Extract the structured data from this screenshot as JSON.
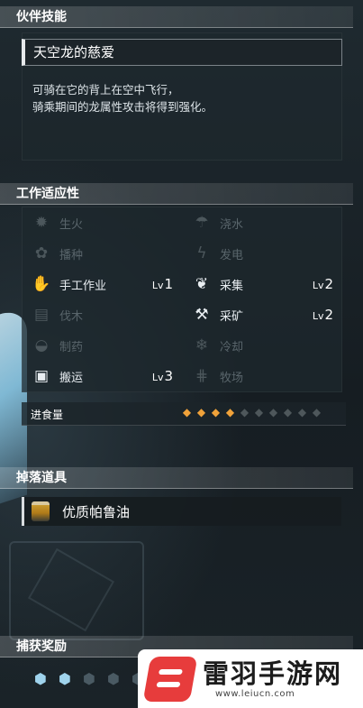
{
  "partner_skill": {
    "header": "伙伴技能",
    "name": "天空龙的慈爱",
    "description_lines": [
      "可骑在它的背上在空中飞行，",
      "骑乘期间的龙属性攻击将得到强化。"
    ]
  },
  "work_suitability": {
    "header": "工作适应性",
    "items": [
      {
        "label": "生火",
        "icon": "flame-icon",
        "glyph": "✹",
        "active": false,
        "lv_prefix": "",
        "lv": ""
      },
      {
        "label": "浇水",
        "icon": "watering-can-icon",
        "glyph": "☂",
        "active": false,
        "lv_prefix": "",
        "lv": ""
      },
      {
        "label": "播种",
        "icon": "sprout-icon",
        "glyph": "✿",
        "active": false,
        "lv_prefix": "",
        "lv": ""
      },
      {
        "label": "发电",
        "icon": "lightning-icon",
        "glyph": "ϟ",
        "active": false,
        "lv_prefix": "",
        "lv": ""
      },
      {
        "label": "手工作业",
        "icon": "hand-icon",
        "glyph": "✋",
        "active": true,
        "lv_prefix": "Lv",
        "lv": "1"
      },
      {
        "label": "采集",
        "icon": "leaf-icon",
        "glyph": "❦",
        "active": true,
        "lv_prefix": "Lv",
        "lv": "2"
      },
      {
        "label": "伐木",
        "icon": "logs-icon",
        "glyph": "▤",
        "active": false,
        "lv_prefix": "",
        "lv": ""
      },
      {
        "label": "采矿",
        "icon": "pickaxe-icon",
        "glyph": "⚒",
        "active": true,
        "lv_prefix": "Lv",
        "lv": "2"
      },
      {
        "label": "制药",
        "icon": "bowl-icon",
        "glyph": "◒",
        "active": false,
        "lv_prefix": "",
        "lv": ""
      },
      {
        "label": "冷却",
        "icon": "snowflake-icon",
        "glyph": "❄",
        "active": false,
        "lv_prefix": "",
        "lv": ""
      },
      {
        "label": "搬运",
        "icon": "box-icon",
        "glyph": "▣",
        "active": true,
        "lv_prefix": "Lv",
        "lv": "3"
      },
      {
        "label": "牧场",
        "icon": "fence-icon",
        "glyph": "⋕",
        "active": false,
        "lv_prefix": "",
        "lv": ""
      }
    ],
    "food": {
      "label": "进食量",
      "filled": 4,
      "total": 10
    }
  },
  "drops": {
    "header": "掉落道具",
    "item": "优质帕鲁油"
  },
  "capture_rewards": {
    "header": "捕获奖励",
    "filled": 2,
    "shown": 5
  },
  "watermark": {
    "title": "雷羽手游网",
    "url": "www.leiucn.com"
  },
  "colors": {
    "active_text": "#ffffff",
    "inactive_text": "#59656b",
    "food_full": "#f0a23a",
    "reward_on": "#9fd3ec",
    "watermark_red": "#e73c3c"
  }
}
